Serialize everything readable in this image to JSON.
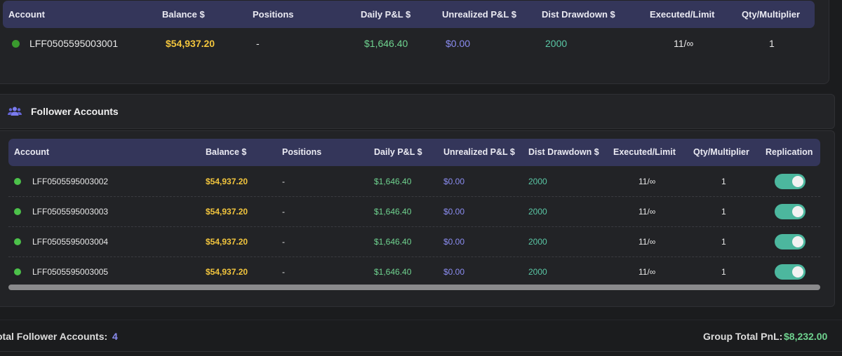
{
  "colors": {
    "header_bg": "#34365a",
    "balance": "#f2c53d",
    "daily_pnl": "#6fd38f",
    "unrealized_pnl": "#8a8cf0",
    "drawdown": "#5ac7a5",
    "status_dot": "#4cc14a",
    "toggle_on": "#4cb79e"
  },
  "leader": {
    "columns": [
      "Account",
      "Balance $",
      "Positions",
      "Daily P&L $",
      "Unrealized P&L $",
      "Dist Drawdown $",
      "Executed/Limit",
      "Qty/Multiplier"
    ],
    "row": {
      "account": "LFF0505595003001",
      "balance": "$54,937.20",
      "positions": "-",
      "daily_pnl": "$1,646.40",
      "unrealized_pnl": "$0.00",
      "dist_drawdown": "2000",
      "executed_limit": "11/∞",
      "qty_multiplier": "1"
    }
  },
  "followers": {
    "title": "Follower Accounts",
    "icon": "users-icon",
    "columns": [
      "Account",
      "Balance $",
      "Positions",
      "Daily P&L $",
      "Unrealized P&L $",
      "Dist Drawdown $",
      "Executed/Limit",
      "Qty/Multiplier",
      "Replication"
    ],
    "rows": [
      {
        "account": "LFF0505595003002",
        "balance": "$54,937.20",
        "positions": "-",
        "daily_pnl": "$1,646.40",
        "unrealized_pnl": "$0.00",
        "dist_drawdown": "2000",
        "executed_limit": "11/∞",
        "qty_multiplier": "1",
        "replication": true
      },
      {
        "account": "LFF0505595003003",
        "balance": "$54,937.20",
        "positions": "-",
        "daily_pnl": "$1,646.40",
        "unrealized_pnl": "$0.00",
        "dist_drawdown": "2000",
        "executed_limit": "11/∞",
        "qty_multiplier": "1",
        "replication": true
      },
      {
        "account": "LFF0505595003004",
        "balance": "$54,937.20",
        "positions": "-",
        "daily_pnl": "$1,646.40",
        "unrealized_pnl": "$0.00",
        "dist_drawdown": "2000",
        "executed_limit": "11/∞",
        "qty_multiplier": "1",
        "replication": true
      },
      {
        "account": "LFF0505595003005",
        "balance": "$54,937.20",
        "positions": "-",
        "daily_pnl": "$1,646.40",
        "unrealized_pnl": "$0.00",
        "dist_drawdown": "2000",
        "executed_limit": "11/∞",
        "qty_multiplier": "1",
        "replication": true
      }
    ]
  },
  "footer": {
    "total_label": "otal Follower Accounts:",
    "total_value": "4",
    "group_label": "Group Total PnL:",
    "group_value": "$8,232.00"
  }
}
